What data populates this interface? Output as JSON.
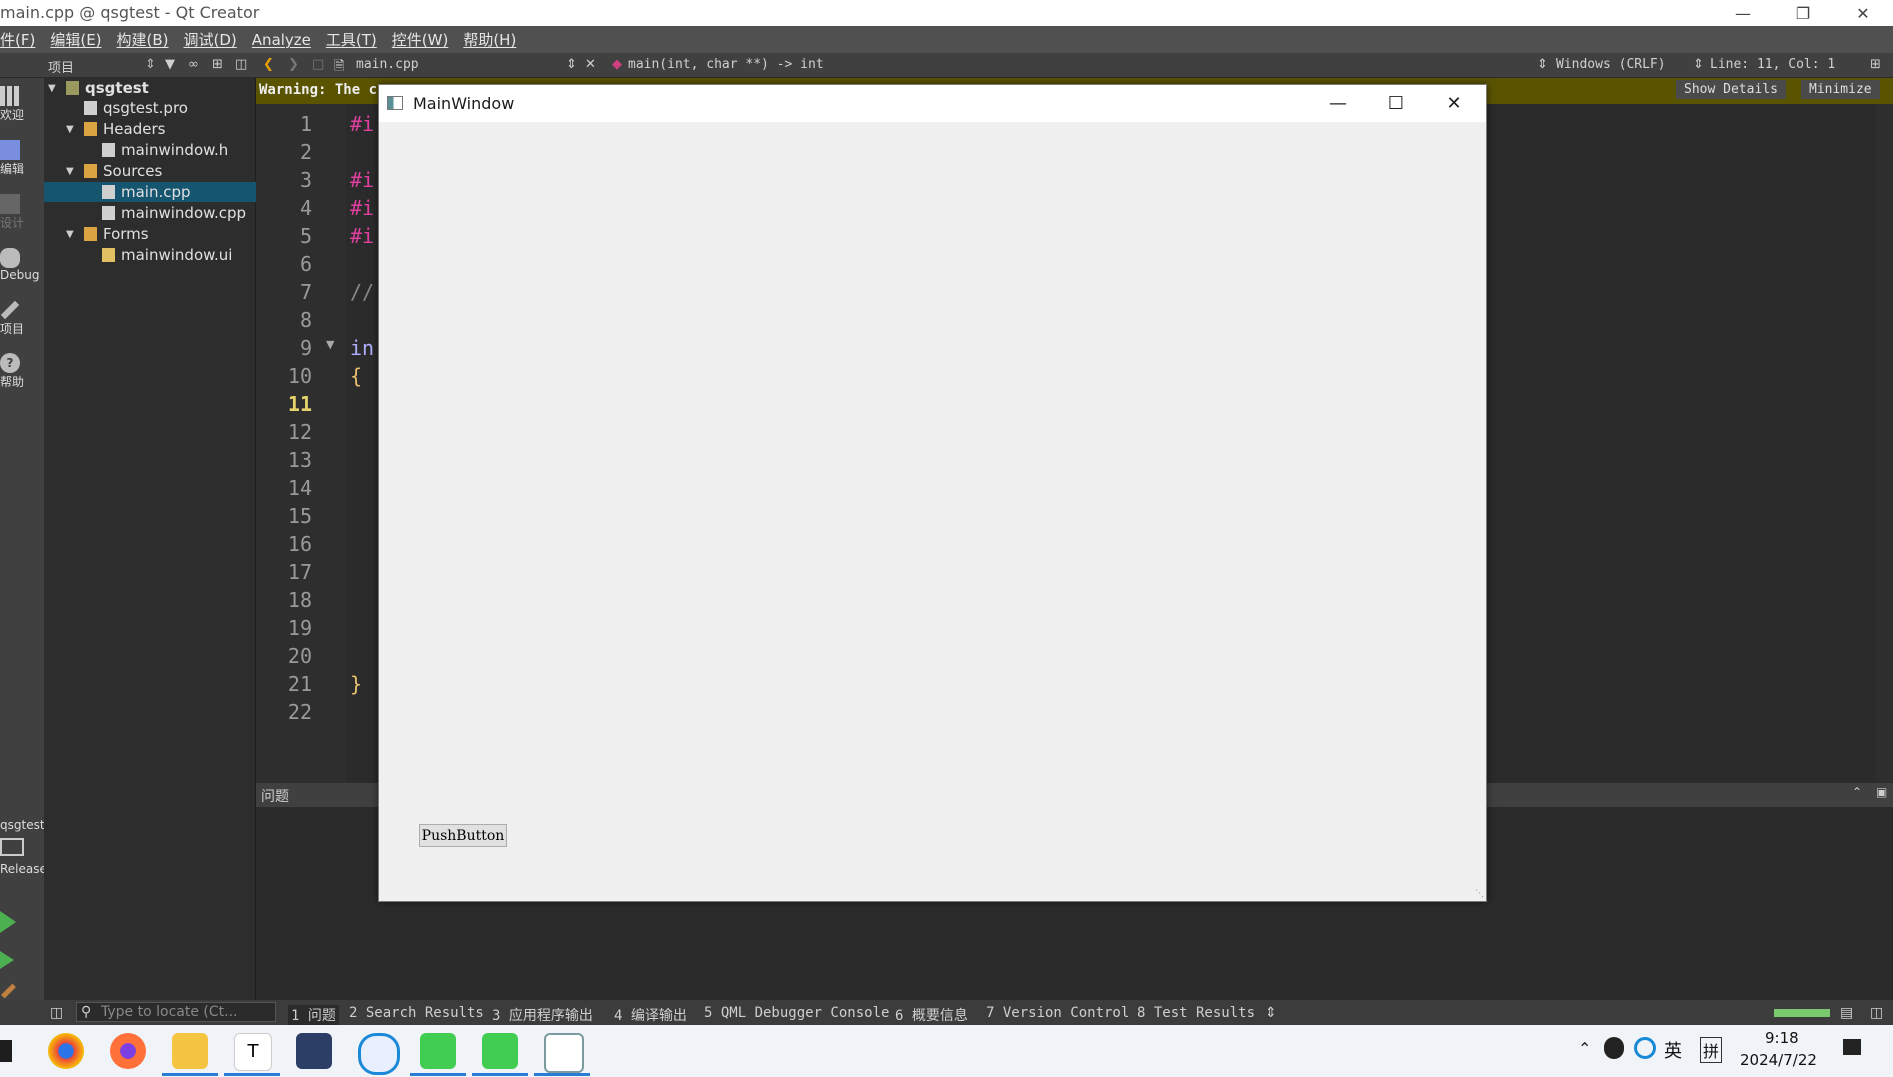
{
  "app": {
    "window_title": "main.cpp @ qsgtest - Qt Creator"
  },
  "menu": [
    "件(F)",
    "编辑(E)",
    "构建(B)",
    "调试(D)",
    "Analyze",
    "工具(T)",
    "控件(W)",
    "帮助(H)"
  ],
  "toolbar": {
    "project_combo": "项目",
    "file_combo": "main.cpp",
    "symbol_combo": "main(int, char **) -> int",
    "encoding": "Windows (CRLF)",
    "position": "Line: 11, Col: 1"
  },
  "modes": [
    "欢迎",
    "编辑",
    "设计",
    "Debug",
    "项目",
    "帮助"
  ],
  "kit": {
    "project": "qsgtest",
    "build": "Release"
  },
  "tree": {
    "root": "qsgtest",
    "pro": "qsgtest.pro",
    "headers": "Headers",
    "header_file": "mainwindow.h",
    "sources": "Sources",
    "source_files": [
      "main.cpp",
      "mainwindow.cpp"
    ],
    "forms": "Forms",
    "form_file": "mainwindow.ui"
  },
  "warning": {
    "text": "Warning: The c",
    "show_details": "Show Details",
    "minimize": "Minimize"
  },
  "editor": {
    "line_numbers": [
      "1",
      "2",
      "3",
      "4",
      "5",
      "6",
      "7",
      "8",
      "9",
      "10",
      "11",
      "12",
      "13",
      "14",
      "15",
      "16",
      "17",
      "18",
      "19",
      "20",
      "21",
      "22"
    ],
    "current_line": "11",
    "code_fragments": {
      "l1": "#i",
      "l3": "#i",
      "l4": "#i",
      "l5": "#i",
      "l7": "//",
      "l9": "in",
      "l10": "{",
      "l21": "}"
    }
  },
  "output_pane": {
    "title": "问题"
  },
  "statusbar": {
    "locator_placeholder": "Type to locate (Ct...",
    "tabs": [
      "1 问题",
      "2 Search Results",
      "3 应用程序输出",
      "4 编译输出",
      "5 QML Debugger Console",
      "6 概要信息",
      "7 Version Control",
      "8 Test Results"
    ]
  },
  "main_window": {
    "title": "MainWindow",
    "button_label": "PushButton"
  },
  "taskbar": {
    "time": "9:18",
    "date": "2024/7/22",
    "ime_lang": "英",
    "ime_mode": "拼"
  },
  "colors": {
    "accent": "#155570",
    "warning_bg": "#5a5400",
    "green": "#4caf50"
  }
}
